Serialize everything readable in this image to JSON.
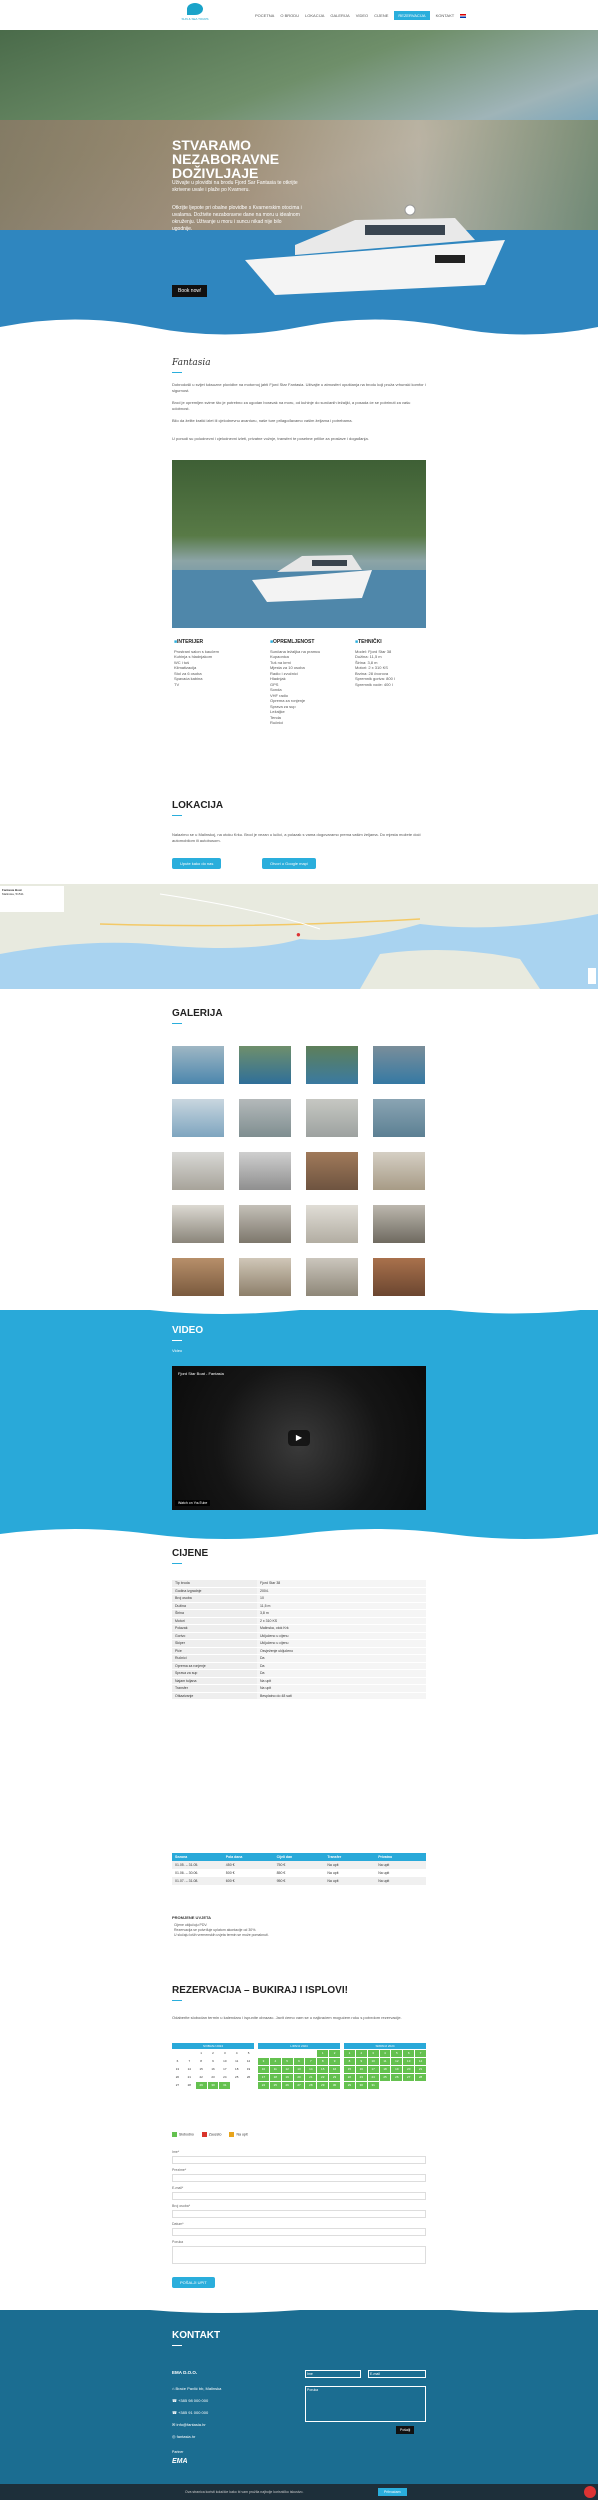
{
  "nav": {
    "logo_text": "SUN & SEA TOURS",
    "items": [
      "Pocetna",
      "O brodu",
      "Lokacija",
      "Galerija",
      "Video",
      "Cijene"
    ],
    "cta": "Rezervacija",
    "last": "Kontakt"
  },
  "hero": {
    "title": "Stvaramo nezaboravne doživljaje",
    "p1": "Uživajte u plovidbi na brodu Fjord Sar Fantasia te otkrijte skrivene uvale i plaže po Kvarneru.",
    "p2": "Otkrijte ljepote pri obalne plovidbe s Kvarnerskim otocima i uvalama. Doživite nezaboravne dane na moru u idealnom okruženju. Uživanje u moru i suncu nikad nije bilo ugodnije.",
    "button": "Book now!"
  },
  "about": {
    "signature": "Fantasia",
    "p1": "Dobrodošli u svijet luksuzne plovidbe na motornoj jahti Fjord Star Fantasia. Uživajte u atmosferi opuštanja na brodu koji pruža vrhunski komfor i sigurnost.",
    "p2": "Brod je opremljen svime što je potrebno za ugodan boravak na moru, od kuhinje do sunčanih ležaljki, a posada će se pobrinuti za vašu udobnost.",
    "p3": "Bilo da želite kratki izlet ili cjelodnevnu avanturu, naše ture prilagođavamo vašim željama i potrebama.",
    "p4": "U ponudi su poludnevni i cjelodnevni izleti, privatne vožnje, transferi te posebne prilike za proslave i događanja."
  },
  "features": [
    {
      "title": "INTERIJER",
      "items": [
        "Prostrani salon s kaučem",
        "Kuhinja s hladnjakom",
        "WC i tuš",
        "Klimatizacija",
        "Stol za 6 osoba",
        "Spavaća kabina",
        "TV"
      ]
    },
    {
      "title": "OPREMLJENOST",
      "items": [
        "Sunčana ležaljka na pramcu",
        "Kupaonica",
        "Tuš na krmi",
        "Mjesta za 10 osoba",
        "Radio i zvučnici",
        "Hladnjak",
        "GPS",
        "Sonda",
        "VHF radio",
        "Oprema za ronjenje",
        "Sprava za sup",
        "Ležaljke",
        "Tenda",
        "Ručnici"
      ]
    },
    {
      "title": "TEHNIČKI",
      "items": [
        "Model: Fjord Star 38",
        "Dužina: 11,5 m",
        "Širina: 3,8 m",
        "Motori: 2 x 310 KS",
        "Brzina: 28 čvorova",
        "Spremnik goriva: 800 l",
        "Spremnik vode: 400 l"
      ]
    }
  ],
  "location": {
    "title": "Lokacija",
    "text": "Nalazimo se u Malinskoj, na otoku Krku. Brod je vezan u lučici, a polazak s vama dogovaramo prema vašim željama. Do mjesta možete doći automobilom ili autobusom.",
    "btn1": "Upute kako do nas",
    "btn2": "Otvori u Google mapi",
    "map_place": "Fantasia Boat",
    "map_sub": "Malinska, 51511"
  },
  "gallery": {
    "title": "Galerija"
  },
  "video": {
    "title": "Video",
    "sub": "Video",
    "caption": "Fjord Star Boat - Fantasia",
    "watch": "Watch on YouTube"
  },
  "prices": {
    "title": "Cijene",
    "rows": [
      [
        "Tip broda",
        "Fjord Star 38"
      ],
      [
        "Godina izgradnje",
        "2004."
      ],
      [
        "Broj osoba",
        "10"
      ],
      [
        "Dužina",
        "11,5 m"
      ],
      [
        "Širina",
        "3,8 m"
      ],
      [
        "Motori",
        "2 x 310 KS"
      ],
      [
        "Polazak",
        "Malinska, otok Krk"
      ],
      [
        "Gorivo",
        "Uključeno u cijenu"
      ],
      [
        "Skiper",
        "Uključeno u cijenu"
      ],
      [
        "Piće",
        "Osvježenje uključeno"
      ],
      [
        "Ručnici",
        "Da"
      ],
      [
        "Oprema za ronjenje",
        "Da"
      ],
      [
        "Sprava za sup",
        "Da"
      ],
      [
        "Najam tuljana",
        "Na upit"
      ],
      [
        "Transfer",
        "Na upit"
      ],
      [
        "Otkazivanje",
        "Besplatno do 48 sati"
      ]
    ],
    "rate_head": [
      "Sezona",
      "Pola dana",
      "Cijeli dan",
      "Transfer",
      "Privatno"
    ],
    "rate_rows": [
      [
        "01.05. – 31.05.",
        "450 €",
        "750 €",
        "Na upit",
        "Na upit"
      ],
      [
        "01.06. – 30.06.",
        "500 €",
        "850 €",
        "Na upit",
        "Na upit"
      ],
      [
        "01.07. – 31.08.",
        "600 €",
        "950 €",
        "Na upit",
        "Na upit"
      ]
    ],
    "note_title": "PROMJENE UVJETA",
    "notes": [
      "Cijene uključuju PDV.",
      "Rezervacija se potvrđuje uplatom akontacije od 30%.",
      "U slučaju loših vremenskih uvjeta termin se može pomaknuti."
    ]
  },
  "booking": {
    "title": "Rezervacija – Bukiraj i isplovi!",
    "text": "Odaberite slobodan termin u kalendaru i ispunite obrazac. Javit ćemo vam se u najkraćem mogućem roku s potvrdom rezervacije.",
    "months": [
      "SVIBANJ 2024",
      "LIPANJ 2024",
      "SRPANJ 2024"
    ],
    "legend": [
      "Slobodno",
      "Zauzeto",
      "Na upit"
    ],
    "fields": [
      "Ime*",
      "Prezime*",
      "E-mail*",
      "Broj osoba*",
      "Datum*",
      "Poruka"
    ],
    "submit": "POŠALJI UPIT"
  },
  "contact": {
    "title": "Kontakt",
    "company": "EMA D.O.O.",
    "lines": [
      "Braće Pavlić bb, Malinska",
      "+385 98 000 000",
      "+385 91 000 000",
      "info@fantasia.hr",
      "fantasia.hr"
    ],
    "form_name": "Ime",
    "form_email": "E-mail",
    "form_msg": "Poruka",
    "send": "Pošalji",
    "partner": "Partner",
    "partner_logo": "EMA"
  },
  "cookie": {
    "text": "Ova stranica koristi kolačiće kako bi vam pružila najbolje korisničko iskustvo.",
    "accept": "Prihvaćam"
  }
}
